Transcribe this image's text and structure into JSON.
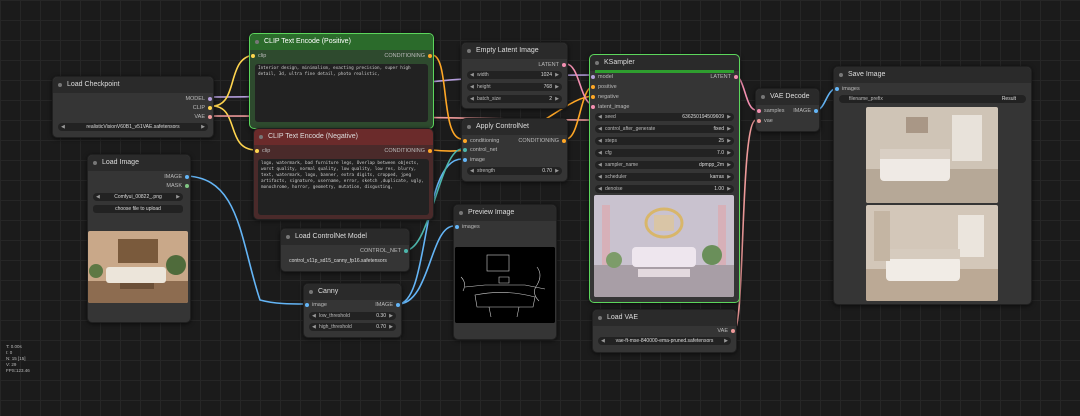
{
  "colors": {
    "model": "#b39ddb",
    "clip": "#ffd54f",
    "vae": "#ef9a9a",
    "conditioning": "#ffa726",
    "latent": "#f48fb1",
    "image": "#64b5f6",
    "control_net": "#4db6ac"
  },
  "load_checkpoint": {
    "title": "Load Checkpoint",
    "outputs": [
      "MODEL",
      "CLIP",
      "VAE"
    ],
    "widget": {
      "label": "ckpt_name",
      "value": "realisticVisionV60B1_v51VAE.safetensors"
    }
  },
  "clip_pos": {
    "title": "CLIP Text Encode (Positive)",
    "input": "clip",
    "output": "CONDITIONING",
    "text": "Interior design,  minimalism,  exacting precision, super high detail, 3d, ultra fine detail, photo realistic,"
  },
  "clip_neg": {
    "title": "CLIP Text Encode (Negative)",
    "input": "clip",
    "output": "CONDITIONING",
    "text": "logo, watermark, bad furniture legs, Overlap between objects, worst quality, normal quality, low quality, low res, blurry, text, watermark, logo, banner, extra digits, cropped, jpeg artifacts, signature, username, error, sketch ,duplicate, ugly, monochrome, horror, geometry, mutation, disgusting,"
  },
  "empty_latent": {
    "title": "Empty Latent Image",
    "output": "LATENT",
    "widgets": [
      {
        "label": "width",
        "value": "1024"
      },
      {
        "label": "height",
        "value": "768"
      },
      {
        "label": "batch_size",
        "value": "2"
      }
    ]
  },
  "apply_cn": {
    "title": "Apply ControlNet",
    "inputs": [
      "conditioning",
      "control_net",
      "image"
    ],
    "output": "CONDITIONING",
    "widget": {
      "label": "strength",
      "value": "0.70"
    }
  },
  "ksampler": {
    "title": "KSampler",
    "inputs": [
      "model",
      "positive",
      "negative",
      "latent_image"
    ],
    "output": "LATENT",
    "widgets": [
      {
        "label": "seed",
        "value": "636250194509609"
      },
      {
        "label": "control_after_generate",
        "value": "fixed"
      },
      {
        "label": "steps",
        "value": "25"
      },
      {
        "label": "cfg",
        "value": "7.0"
      },
      {
        "label": "sampler_name",
        "value": "dpmpp_2m"
      },
      {
        "label": "scheduler",
        "value": "karras"
      },
      {
        "label": "denoise",
        "value": "1.00"
      }
    ]
  },
  "vae_decode": {
    "title": "VAE Decode",
    "inputs": [
      "samples",
      "vae"
    ],
    "output": "IMAGE"
  },
  "save_image": {
    "title": "Save Image",
    "input": "images",
    "widget": {
      "label": "filename_prefix",
      "value": "Result"
    }
  },
  "load_image": {
    "title": "Load Image",
    "outputs": [
      "IMAGE",
      "MASK"
    ],
    "widget": {
      "label": "image",
      "value": "Comfyui_00822_.png"
    },
    "button": "choose file to upload"
  },
  "load_cn_model": {
    "title": "Load ControlNet Model",
    "output": "CONTROL_NET",
    "widget": {
      "label": "control_net_name",
      "value": "control_v11p_sd15_canny_fp16.safetensors"
    }
  },
  "canny": {
    "title": "Canny",
    "input": "image",
    "output": "IMAGE",
    "widgets": [
      {
        "label": "low_threshold",
        "value": "0.30"
      },
      {
        "label": "high_threshold",
        "value": "0.70"
      }
    ]
  },
  "preview_image": {
    "title": "Preview Image",
    "input": "images"
  },
  "load_vae": {
    "title": "Load VAE",
    "output": "VAE",
    "widget": {
      "label": "vae_name",
      "value": "vae-ft-mse-840000-ema-pruned.safetensors"
    }
  },
  "status": [
    "T: 0.00s",
    "I: 0",
    "N: 15 [15]",
    "V: 29",
    "FPS:123.46"
  ]
}
